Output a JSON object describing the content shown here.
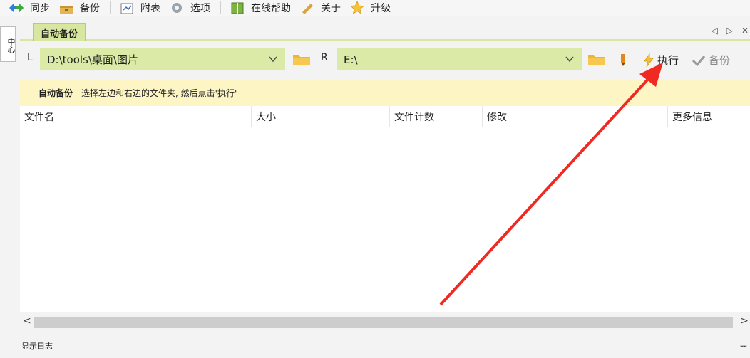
{
  "toolbar": {
    "items": [
      {
        "label": "同步",
        "icon": "sync-arrows-icon"
      },
      {
        "label": "备份",
        "icon": "backup-box-icon"
      },
      {
        "label": "附表",
        "icon": "schedule-icon"
      },
      {
        "label": "选项",
        "icon": "gear-icon"
      },
      {
        "label": "在线帮助",
        "icon": "help-book-icon"
      },
      {
        "label": "关于",
        "icon": "info-pencil-icon"
      },
      {
        "label": "升级",
        "icon": "star-icon"
      }
    ]
  },
  "side_tab": {
    "label": "中心"
  },
  "tab": {
    "label": "自动备份",
    "controls": [
      "◁",
      "▷",
      "✕"
    ]
  },
  "left_path": {
    "side": "L",
    "value": "D:\\tools\\桌面\\图片"
  },
  "right_path": {
    "side": "R",
    "value": "E:\\"
  },
  "actions": {
    "execute": "执行",
    "backup": "备份"
  },
  "hint": {
    "title": "自动备份",
    "text": "选择左边和右边的文件夹, 然后点击'执行'"
  },
  "columns": [
    "文件名",
    "大小",
    "文件计数",
    "修改",
    "更多信息"
  ],
  "footer": {
    "log": "显示日志",
    "pin": "ᅲ"
  },
  "colors": {
    "accent": "#d8e79f",
    "path_bg": "#dbeaa6",
    "hint_bg": "#fdf6c4",
    "arrow": "#f02a22"
  }
}
